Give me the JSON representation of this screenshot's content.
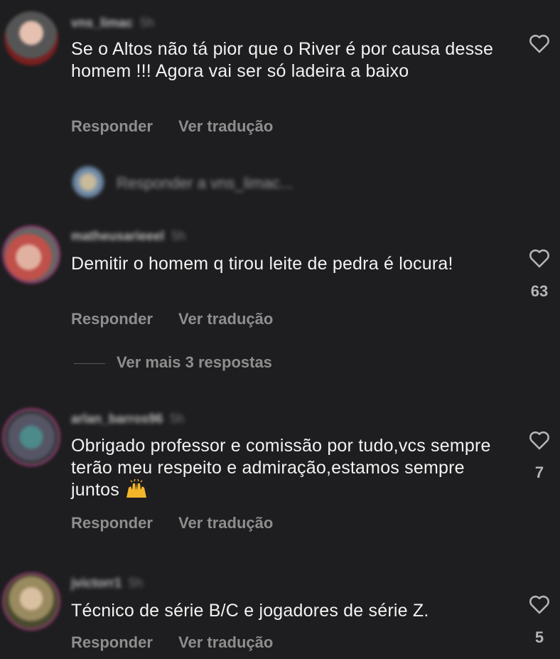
{
  "comments": [
    {
      "username": "vns_limac",
      "time": "5h",
      "text": "Se o Altos não tá pior que o River é por causa desse homem !!! Agora vai ser só ladeira a baixo",
      "reply_label": "Responder",
      "translate_label": "Ver tradução",
      "likes": ""
    },
    {
      "username": "matheusarieeel",
      "time": "5h",
      "text": "Demitir o homem q tirou leite de pedra é locura!",
      "reply_label": "Responder",
      "translate_label": "Ver tradução",
      "likes": "63"
    },
    {
      "username": "arlan_barros96",
      "time": "5h",
      "text": "Obrigado professor e comissão por tudo,vcs sempre terão meu respeito e admiração,estamos sempre juntos",
      "reply_label": "Responder",
      "translate_label": "Ver tradução",
      "likes": "7"
    },
    {
      "username": "jvictorr1",
      "time": "5h",
      "text": "Técnico de série B/C e jogadores de série Z.",
      "reply_label": "Responder",
      "translate_label": "Ver tradução",
      "likes": "5"
    }
  ],
  "reply_prompt": "Responder a vns_limac...",
  "view_more_replies": "Ver mais 3 respostas",
  "colors": {
    "background": "#1e1e20",
    "secondary_text": "#8e8e8e",
    "story_ring": "#8b3a6b"
  },
  "icons": [
    "heart-icon",
    "raising-hands-emoji"
  ]
}
